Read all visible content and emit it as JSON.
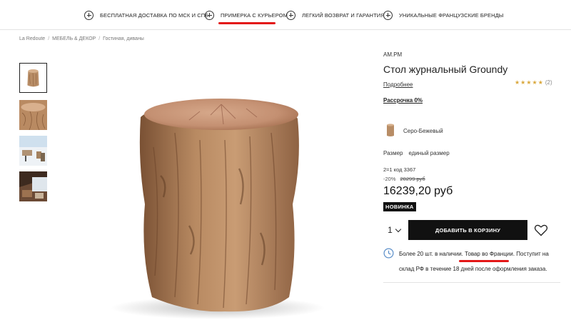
{
  "perks": [
    {
      "label": "БЕСПЛАТНАЯ ДОСТАВКА ПО МСК И СПБ",
      "icon": "plus-circle-icon"
    },
    {
      "label": "ПРИМЕРКА С КУРЬЕРОМ",
      "icon": "plus-circle-icon"
    },
    {
      "label": "ЛЕГКИЙ ВОЗВРАТ И ГАРАНТИЯ",
      "icon": "plus-circle-icon"
    },
    {
      "label": "УНИКАЛЬНЫЕ ФРАНЦУЗСКИЕ БРЕНДЫ",
      "icon": "plus-circle-icon"
    }
  ],
  "breadcrumb": [
    "La Redoute",
    "МЕБЕЛЬ & ДЕКОР",
    "Гостиная, диваны"
  ],
  "breadcrumb_sep": "/",
  "product": {
    "brand": "AM.PM",
    "title": "Стол журнальный Groundy",
    "more_link": "Подробнее",
    "rating_stars": "★★★★★",
    "rating_count": "(2)",
    "installment": "Рассрочка 0%",
    "color_name": "Серо-Бежевый",
    "size_label": "Размер",
    "size_value": "единый размер",
    "promo": "2=1 код 3367",
    "discount": "-20%",
    "old_price": "20299 руб",
    "price": "16239,20 руб",
    "badge": "НОВИНКА",
    "qty": "1",
    "add_to_cart": "ДОБАВИТЬ В КОРЗИНУ",
    "stock_line1": "Более 20 шт. в наличии. Товар во Франции. Поступит на",
    "stock_line2": "склад РФ в течение 18 дней после оформления заказа."
  },
  "colors": {
    "annotation_red": "#e31717",
    "button_black": "#111111",
    "star_gold": "#d9a73b",
    "clock_blue": "#5b8fc9",
    "wood_light": "#d4aa84",
    "wood_dark": "#8a5e3c"
  },
  "icons": [
    "plus-circle-icon",
    "chevron-down-icon",
    "heart-icon",
    "clock-icon"
  ]
}
